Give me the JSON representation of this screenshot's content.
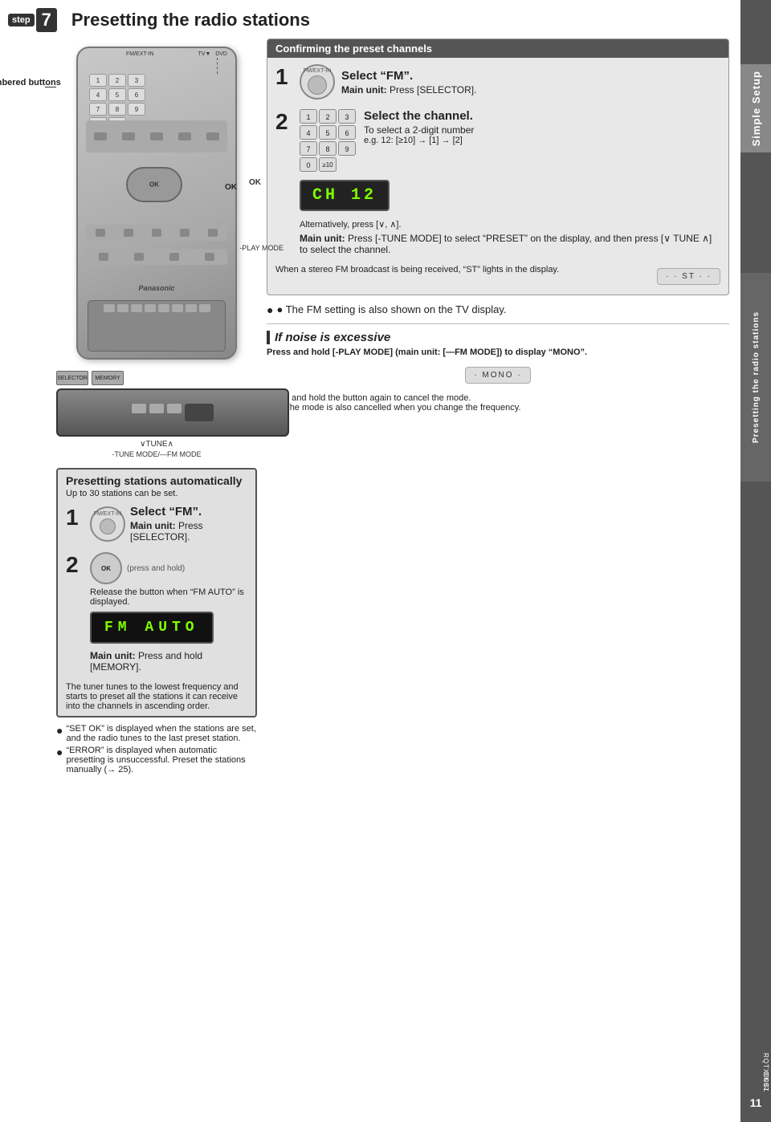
{
  "page": {
    "step_badge": "step",
    "step_number": "7",
    "title": "Presetting the radio stations",
    "page_number": "11",
    "rqtx": "RQTX0087",
    "english": "ENGLISH"
  },
  "sidebar": {
    "simple_setup": "Simple Setup",
    "presetting": "Presetting the radio stations"
  },
  "confirm_section": {
    "title": "Confirming the preset channels",
    "step1": {
      "number": "1",
      "icon_label": "FM/EXT-IN",
      "select_title": "Select “FM”.",
      "main_unit_label": "Main unit:",
      "main_unit_text": "Press [SELECTOR]."
    },
    "step2": {
      "number": "2",
      "select_title": "Select the channel.",
      "bullet1": "To select a 2-digit number",
      "example": "e.g. 12: [≥10] → [1] → [2]",
      "display_text": "CH  12",
      "alt_text": "Alternatively, press [∨, ∧].",
      "main_unit_label": "Main unit:",
      "tune_mode_text": "Press [-TUNE MODE] to select “PRESET” on the display, and then press [∨ TUNE ∧] to select the channel."
    },
    "stereo_note": "When a stereo FM broadcast is being received, “ST” lights in the display.",
    "fm_note": "● The FM setting is also shown on the TV display."
  },
  "if_noise": {
    "title": "If noise is excessive",
    "instruction": "Press and hold [-PLAY MODE] (main unit: [—FM MODE]) to display “MONO”.",
    "cancel_note1": "Press and hold the button again to cancel the mode.",
    "cancel_note2": "● The mode is also cancelled when you change the frequency."
  },
  "preset_auto": {
    "title": "Presetting stations automatically",
    "subtitle": "Up to 30 stations can be set.",
    "step1": {
      "number": "1",
      "icon_label": "FM/EXT-IN",
      "select_title": "Select “FM”.",
      "main_unit_label": "Main unit:",
      "main_unit_text": "Press [SELECTOR]."
    },
    "step2": {
      "number": "2",
      "icon_label": "OK",
      "press_hold": "(press and hold)",
      "release_text": "Release the button when “FM AUTO” is displayed.",
      "display_text": "FM  AUTO",
      "main_unit_label": "Main unit:",
      "main_unit_text": "Press and hold [MEMORY]."
    },
    "tuner_note": "The tuner tunes to the lowest frequency and starts to preset all the stations it can receive into the channels in ascending order.",
    "note1": "“SET OK” is displayed when the stations are set, and the radio tunes to the last preset station.",
    "note2": "“ERROR” is displayed when automatic presetting is unsuccessful. Preset the stations manually (→ 25)."
  },
  "remote_labels": {
    "numbered_buttons": "Numbered\nbuttons",
    "fm_ext_in": "FM/EXT-IN",
    "ok": "OK",
    "play_mode": "-PLAY MODE",
    "selector": "SELECTOR",
    "memory": "MEMORY",
    "tune": "∨TUNE∧",
    "tune_mode": "-TUNE MODE/—FM MODE",
    "panasonic": "Panasonic",
    "numbers": [
      "1",
      "2",
      "3",
      "4",
      "5",
      "6",
      "7",
      "8",
      "9",
      "0",
      "≥10"
    ]
  }
}
